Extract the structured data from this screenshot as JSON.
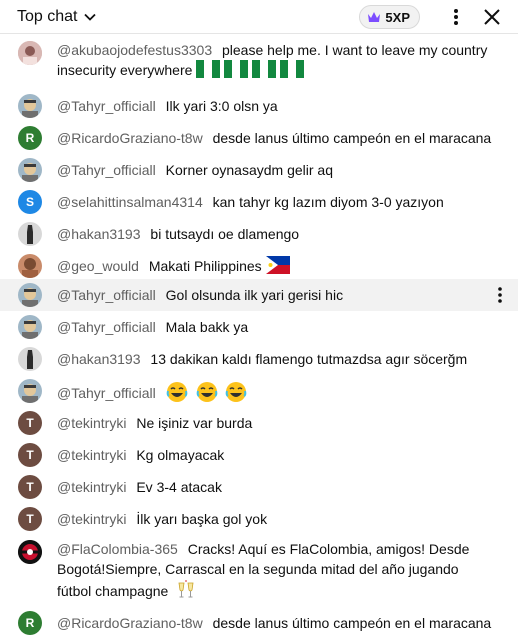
{
  "header": {
    "title": "Top chat",
    "xp_badge": "5XP"
  },
  "colors": {
    "avatar_green": "#2e7d32",
    "avatar_blue": "#1e88e5",
    "avatar_brown": "#6d4c41",
    "highlight_bg": "#f2f2f2",
    "xp_crown": "#7c4dff"
  },
  "messages": [
    {
      "author": "@akubaojodefestus3303",
      "text": "please help me. I want to leave my country insecurity everywhere",
      "avatar": "photo"
    },
    {
      "author": "@Tahyr_officiall",
      "text": "Ilk yari 3:0 olsn ya",
      "avatar": "photo"
    },
    {
      "author": "@RicardoGraziano-t8w",
      "text": "desde lanus último campeón en el maracana",
      "avatar": "R"
    },
    {
      "author": "@Tahyr_officiall",
      "text": "Korner oynasaydm gelir aq",
      "avatar": "photo"
    },
    {
      "author": "@selahittinsalman4314",
      "text": "kan tahyr kg lazım diyom 3-0 yazıyon",
      "avatar": "S"
    },
    {
      "author": "@hakan3193",
      "text": "bi tutsaydı oe dlamengo",
      "avatar": "photo"
    },
    {
      "author": "@geo_would",
      "text": "Makati Philippines",
      "avatar": "photo"
    },
    {
      "author": "@Tahyr_officiall",
      "text": "Gol olsunda ilk yari gerisi hic",
      "avatar": "photo"
    },
    {
      "author": "@Tahyr_officiall",
      "text": "Mala bakk ya",
      "avatar": "photo"
    },
    {
      "author": "@hakan3193",
      "text": "13 dakikan kaldı flamengo tutmazdsa agır söcerğm",
      "avatar": "photo"
    },
    {
      "author": "@Tahyr_officiall",
      "text": "",
      "avatar": "photo"
    },
    {
      "author": "@tekintryki",
      "text": "Ne işiniz var burda",
      "avatar": "T"
    },
    {
      "author": "@tekintryki",
      "text": "Kg olmayacak",
      "avatar": "T"
    },
    {
      "author": "@tekintryki",
      "text": "Ev 3-4 atacak",
      "avatar": "T"
    },
    {
      "author": "@tekintryki",
      "text": "İlk yarı başka gol yok",
      "avatar": "T"
    },
    {
      "author": "@FlaColombia-365",
      "text": "Cracks! Aquí es FlaColombia, amigos! Desde Bogotá!Siempre, Carrascal en la segunda mitad del año jugando fútbol champagne",
      "avatar": "logo"
    },
    {
      "author": "@RicardoGraziano-t8w",
      "text": "desde lanus último campeón en el maracana",
      "avatar": "R"
    }
  ],
  "icons": {
    "header": [
      "chevron-down-icon",
      "crown-icon",
      "more-vert-icon",
      "close-icon"
    ],
    "inline": [
      "nigeria-flag-icon",
      "philippines-flag-icon",
      "laughing-emoji-icon",
      "champagne-icon"
    ]
  }
}
